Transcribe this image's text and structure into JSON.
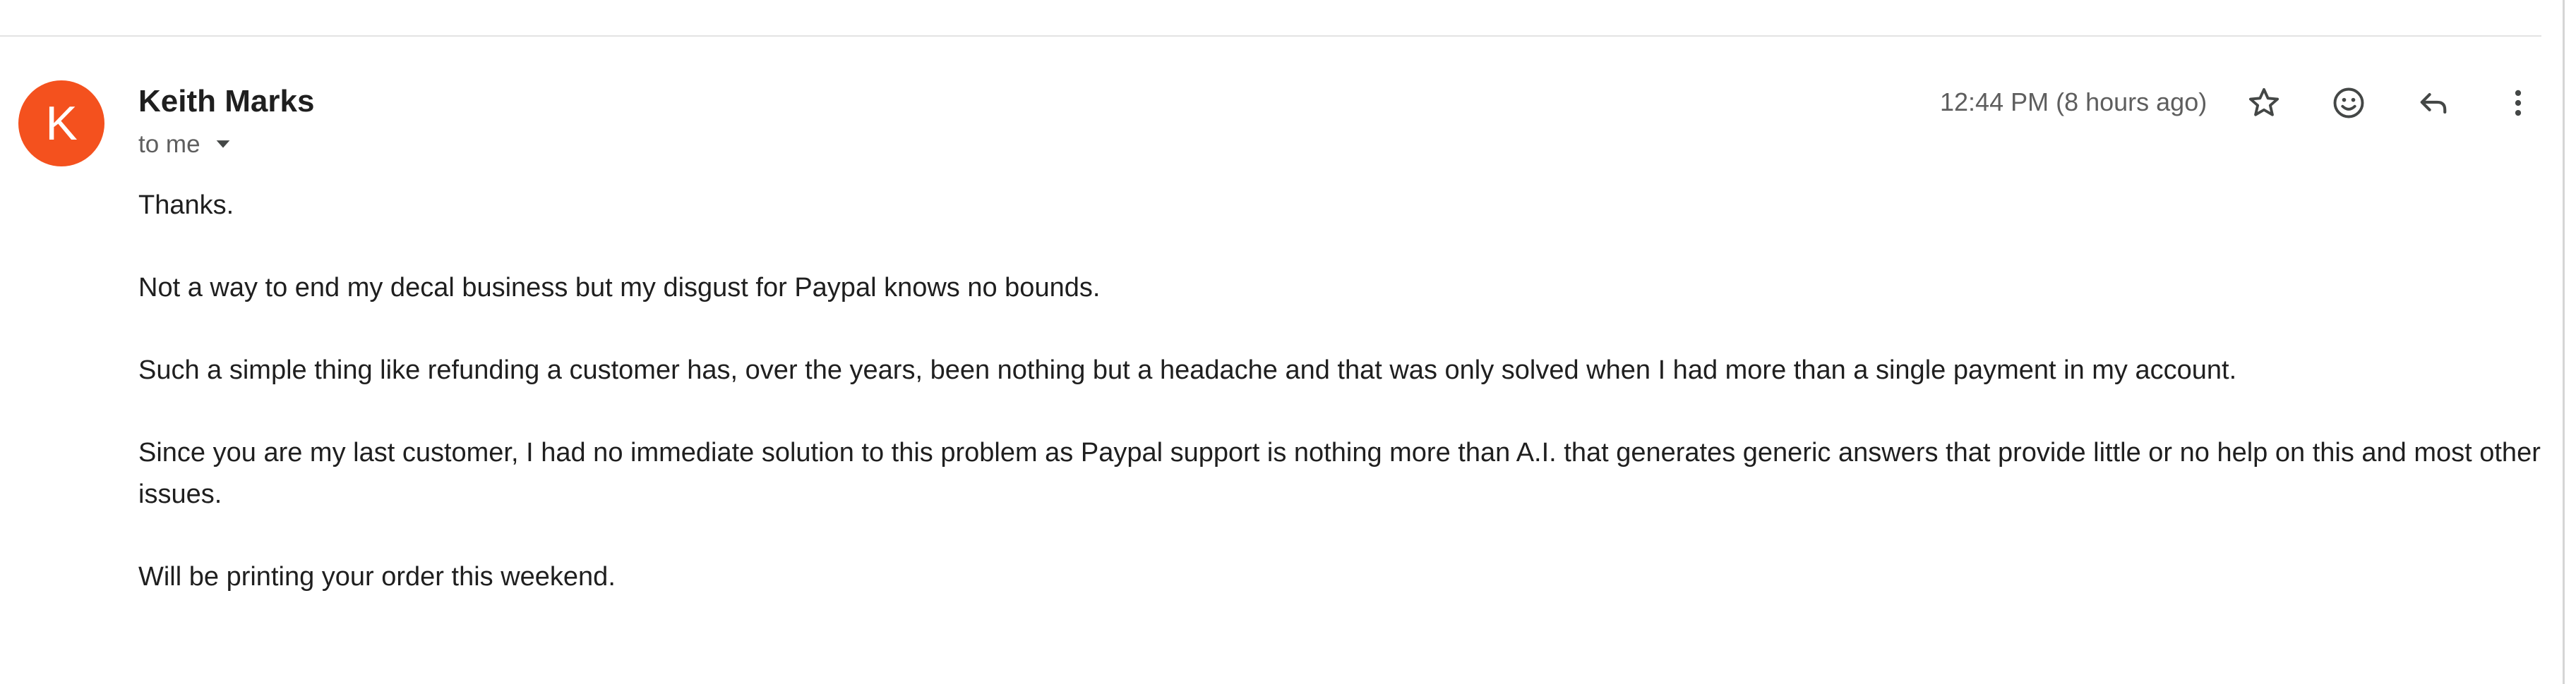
{
  "email": {
    "sender": {
      "initial": "K",
      "name": "Keith Marks",
      "avatar_color": "#f4511e"
    },
    "recipient_label": "to me",
    "timestamp": "12:44 PM (8 hours ago)",
    "actions": {
      "star_icon": "star-icon",
      "emoji_icon": "add-reaction-icon",
      "reply_icon": "reply-icon",
      "more_icon": "more-vert-icon"
    },
    "body": {
      "paragraphs": [
        "Thanks.",
        "Not a way to end my decal business but my disgust for Paypal knows no bounds.",
        "Such a simple thing like refunding a customer has, over the years, been nothing but a headache and that was only solved when I had more than a single payment in my account.",
        "Since you are my last customer, I had no immediate solution to this problem as Paypal support is nothing more than A.I. that generates generic answers that provide little or no help on this and most other issues.",
        "Will be printing your order this weekend."
      ]
    }
  }
}
